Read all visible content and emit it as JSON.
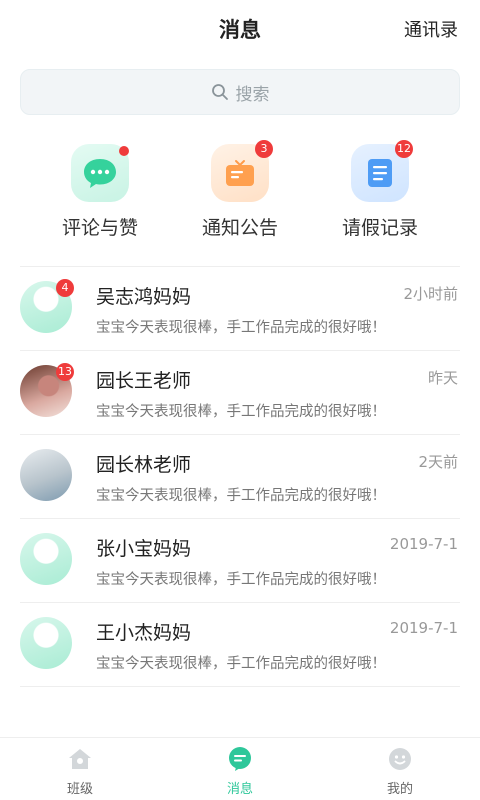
{
  "header": {
    "title": "消息",
    "contacts": "通讯录"
  },
  "search": {
    "placeholder": "搜索"
  },
  "quick": [
    {
      "label": "评论与赞",
      "icon": "chat-bubble-icon",
      "badge": ""
    },
    {
      "label": "通知公告",
      "icon": "notice-icon",
      "badge": "3"
    },
    {
      "label": "请假记录",
      "icon": "document-icon",
      "badge": "12"
    }
  ],
  "messages": [
    {
      "name": "吴志鸿妈妈",
      "time": "2小时前",
      "preview": "宝宝今天表现很棒，手工作品完成的很好哦！",
      "badge": "4"
    },
    {
      "name": "园长王老师",
      "time": "昨天",
      "preview": "宝宝今天表现很棒，手工作品完成的很好哦！",
      "badge": "13"
    },
    {
      "name": "园长林老师",
      "time": "2天前",
      "preview": "宝宝今天表现很棒，手工作品完成的很好哦！",
      "badge": ""
    },
    {
      "name": "张小宝妈妈",
      "time": "2019-7-1",
      "preview": "宝宝今天表现很棒，手工作品完成的很好哦！",
      "badge": ""
    },
    {
      "name": "王小杰妈妈",
      "time": "2019-7-1",
      "preview": "宝宝今天表现很棒，手工作品完成的很好哦！",
      "badge": ""
    }
  ],
  "tabs": [
    {
      "label": "班级",
      "icon": "home-icon"
    },
    {
      "label": "消息",
      "icon": "message-icon",
      "active": true
    },
    {
      "label": "我的",
      "icon": "profile-icon"
    }
  ],
  "colors": {
    "accent": "#2ec79a",
    "badge": "#ef3b3b"
  }
}
